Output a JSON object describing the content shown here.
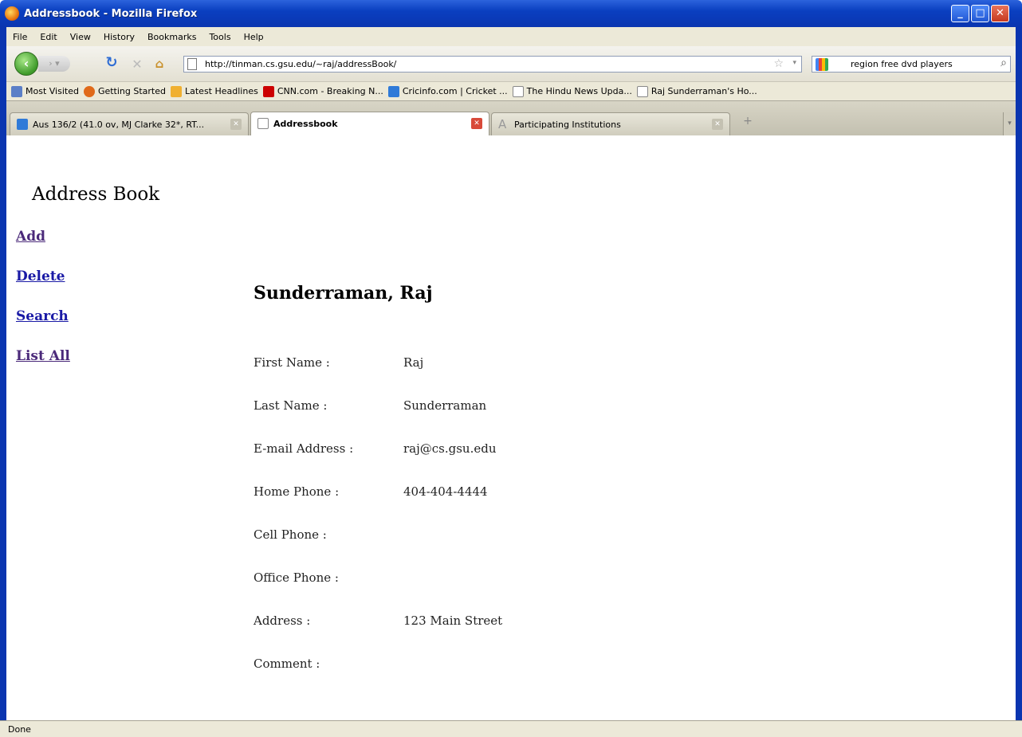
{
  "window": {
    "title": "Addressbook - Mozilla Firefox"
  },
  "menu": [
    "File",
    "Edit",
    "View",
    "History",
    "Bookmarks",
    "Tools",
    "Help"
  ],
  "nav": {
    "url": "http://tinman.cs.gsu.edu/~raj/addressBook/",
    "search_query": "region free dvd players"
  },
  "bookmarks": [
    {
      "label": "Most Visited",
      "icon": "most-visited-icon"
    },
    {
      "label": "Getting Started",
      "icon": "firefox-icon"
    },
    {
      "label": "Latest Headlines",
      "icon": "rss-icon"
    },
    {
      "label": "CNN.com - Breaking N...",
      "icon": "cnn-icon"
    },
    {
      "label": "Cricinfo.com | Cricket ...",
      "icon": "cricinfo-icon"
    },
    {
      "label": "The Hindu News Upda...",
      "icon": "page-icon"
    },
    {
      "label": "Raj Sunderraman's Ho...",
      "icon": "page-icon"
    }
  ],
  "tabs": [
    {
      "label": "Aus 136/2 (41.0 ov, MJ Clarke 32*, RT...",
      "active": false
    },
    {
      "label": "Addressbook",
      "active": true
    },
    {
      "label": "Participating Institutions",
      "active": false
    }
  ],
  "page": {
    "title": "Address Book",
    "links": [
      "Add",
      "Delete",
      "Search",
      "List All"
    ],
    "record_name": "Sunderraman, Raj",
    "fields": [
      {
        "label": "First Name :",
        "value": "Raj"
      },
      {
        "label": "Last Name :",
        "value": "Sunderraman"
      },
      {
        "label": "E-mail Address :",
        "value": "raj@cs.gsu.edu"
      },
      {
        "label": "Home Phone :",
        "value": "404-404-4444"
      },
      {
        "label": "Cell Phone :",
        "value": ""
      },
      {
        "label": "Office Phone :",
        "value": ""
      },
      {
        "label": "Address :",
        "value": "123 Main Street"
      },
      {
        "label": "Comment :",
        "value": ""
      }
    ]
  },
  "status": {
    "text": "Done"
  },
  "colors": {
    "titlebar": "#0a3fc0",
    "link": "#1a1aa6",
    "visited_link": "#4b2a7a"
  }
}
